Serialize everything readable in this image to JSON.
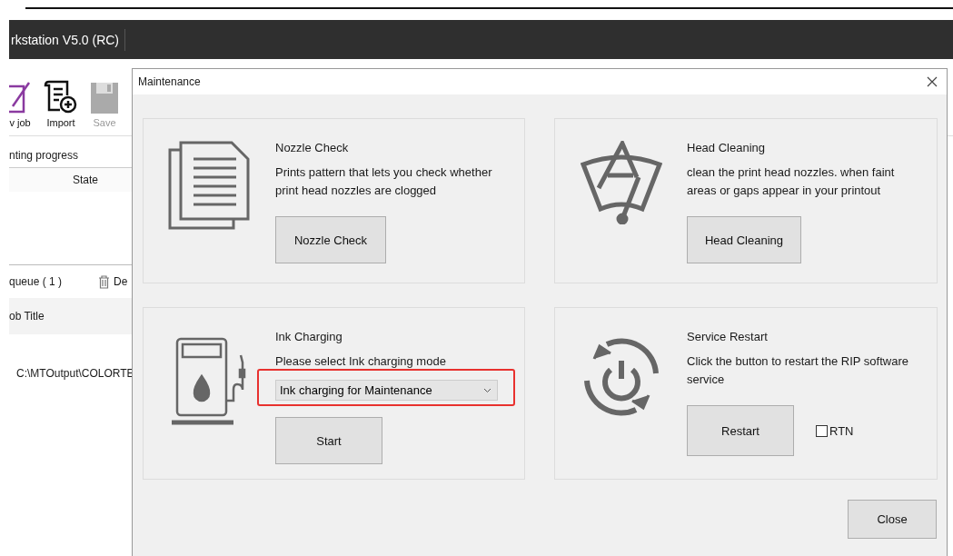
{
  "app": {
    "title": "rkstation V5.0 (RC)",
    "toolbar": [
      {
        "kind": "newjob",
        "label": "v job",
        "disabled": false
      },
      {
        "kind": "import",
        "label": "Import",
        "disabled": false
      },
      {
        "kind": "save",
        "label": "Save",
        "disabled": true
      }
    ],
    "progress_title": "nting progress",
    "progress_columns": [
      "State"
    ],
    "queue_title": "queue ( 1 )",
    "delete_label": "De",
    "queue_columns": [
      "ob Title"
    ],
    "queue_rows": [
      {
        "title": "C:\\MTOutput\\COLORTE"
      }
    ]
  },
  "dialog": {
    "title": "Maintenance",
    "cards": [
      {
        "kind": "document",
        "title": "Nozzle Check",
        "description": "Prints pattern that lets you check whether print head nozzles are clogged",
        "button": "Nozzle Check"
      },
      {
        "kind": "wiper",
        "title": "Head Cleaning",
        "description": "clean the print head nozzles.  when faint areas or gaps appear in your printout",
        "button": "Head Cleaning"
      },
      {
        "kind": "pump",
        "title": "Ink Charging",
        "description": "Please select Ink charging mode",
        "select": {
          "value": "Ink charging for Maintenance",
          "highlighted": true
        },
        "button": "Start"
      },
      {
        "kind": "power",
        "title": "Service Restart",
        "description": "Click the button to restart the RIP software service",
        "button": "Restart",
        "checkbox": {
          "label": "RTN",
          "checked": false
        }
      }
    ],
    "close_button": "Close"
  }
}
